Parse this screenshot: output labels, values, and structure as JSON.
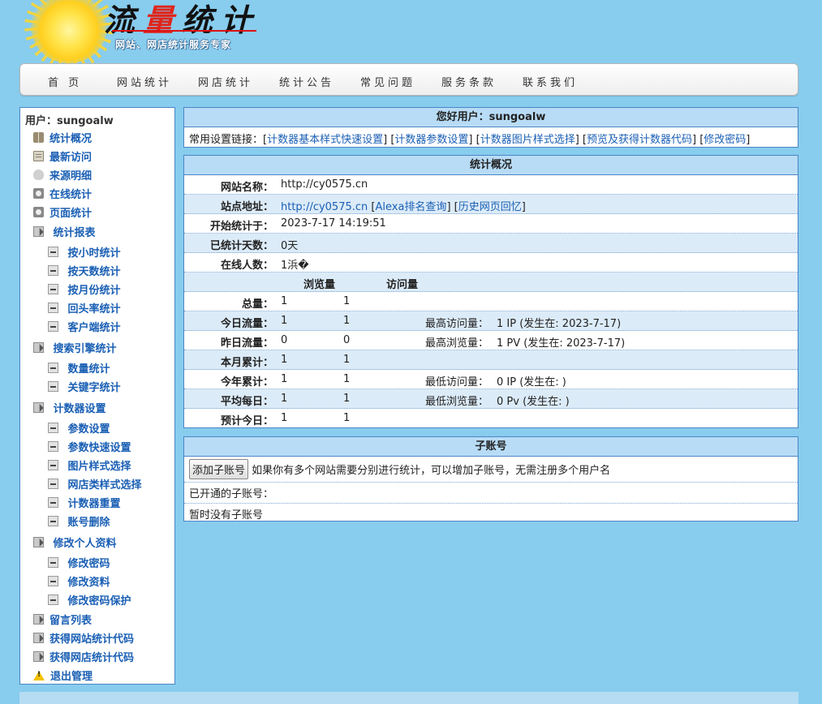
{
  "header": {
    "logo_title_left": "流",
    "logo_title_mid": "量",
    "logo_title_right": "统计",
    "logo_subtitle": "网站、网店统计服务专家"
  },
  "nav": [
    {
      "label": "首 页"
    },
    {
      "label": "网站统计"
    },
    {
      "label": "网店统计"
    },
    {
      "label": "统计公告"
    },
    {
      "label": "常见问题"
    },
    {
      "label": "服务条款"
    },
    {
      "label": "联系我们"
    }
  ],
  "sidebar": {
    "user_label": "用户：sungoalw",
    "items": [
      {
        "label": "统计概况",
        "icon": "book-icon"
      },
      {
        "label": "最新访问",
        "icon": "document-icon"
      },
      {
        "label": "来源明细",
        "icon": "cloud-icon"
      },
      {
        "label": "在线统计",
        "icon": "disc-icon"
      },
      {
        "label": "页面统计",
        "icon": "disc-icon"
      },
      {
        "label": "统计报表",
        "icon": "folder-icon"
      },
      {
        "label": "按小时统计",
        "icon": "minus-icon"
      },
      {
        "label": "按天数统计",
        "icon": "minus-icon"
      },
      {
        "label": "按月份统计",
        "icon": "minus-icon"
      },
      {
        "label": "回头率统计",
        "icon": "minus-icon"
      },
      {
        "label": "客户端统计",
        "icon": "minus-icon"
      },
      {
        "label": "搜索引擎统计",
        "icon": "folder-icon"
      },
      {
        "label": "数量统计",
        "icon": "minus-icon"
      },
      {
        "label": "关键字统计",
        "icon": "minus-icon"
      },
      {
        "label": "计数器设置",
        "icon": "folder-icon"
      },
      {
        "label": "参数设置",
        "icon": "minus-icon"
      },
      {
        "label": "参数快速设置",
        "icon": "minus-icon"
      },
      {
        "label": "图片样式选择",
        "icon": "minus-icon"
      },
      {
        "label": "网店类样式选择",
        "icon": "minus-icon"
      },
      {
        "label": "计数器重置",
        "icon": "minus-icon"
      },
      {
        "label": "账号删除",
        "icon": "minus-icon"
      },
      {
        "label": "修改个人资料",
        "icon": "folder-icon"
      },
      {
        "label": "修改密码",
        "icon": "minus-icon"
      },
      {
        "label": "修改资料",
        "icon": "minus-icon"
      },
      {
        "label": "修改密码保护",
        "icon": "minus-icon"
      },
      {
        "label": "留言列表",
        "icon": "folder-icon"
      },
      {
        "label": "获得网站统计代码",
        "icon": "folder-icon"
      },
      {
        "label": "获得网店统计代码",
        "icon": "folder-icon"
      },
      {
        "label": "退出管理",
        "icon": "warning-icon"
      }
    ]
  },
  "welcome": {
    "title": "您好用户：sungoalw",
    "links_prefix": "常用设置链接：",
    "links": [
      "计数器基本样式快速设置",
      "计数器参数设置",
      "计数器图片样式选择",
      "预览及获得计数器代码",
      "修改密码"
    ]
  },
  "overview": {
    "title": "统计概况",
    "site_name_label": "网站名称：",
    "site_name": "http://cy0575.cn",
    "site_url_label": "站点地址：",
    "site_url": "http://cy0575.cn",
    "alexa_link": "Alexa排名查询",
    "history_link": "历史网页回忆",
    "start_label": "开始统计于：",
    "start_value": "2023-7-17 14:19:51",
    "days_label": "已统计天数：",
    "days_value": "0天",
    "online_label": "在线人数：",
    "online_value": "1浜�",
    "col_pv": "浏览量",
    "col_ip": "访问量",
    "rows": [
      {
        "label": "总量：",
        "pv": "1",
        "ip": "1",
        "extra_label": "",
        "extra_value": ""
      },
      {
        "label": "今日流量：",
        "pv": "1",
        "ip": "1",
        "extra_label": "最高访问量：",
        "extra_value": "1 IP (发生在: 2023-7-17)"
      },
      {
        "label": "昨日流量：",
        "pv": "0",
        "ip": "0",
        "extra_label": "最高浏览量：",
        "extra_value": "1 PV (发生在: 2023-7-17)"
      },
      {
        "label": "本月累计：",
        "pv": "1",
        "ip": "1",
        "extra_label": "",
        "extra_value": ""
      },
      {
        "label": "今年累计：",
        "pv": "1",
        "ip": "1",
        "extra_label": "最低访问量：",
        "extra_value": "0 IP (发生在: )"
      },
      {
        "label": "平均每日：",
        "pv": "1",
        "ip": "1",
        "extra_label": "最低浏览量：",
        "extra_value": "0 Pv (发生在: )"
      },
      {
        "label": "预计今日：",
        "pv": "1",
        "ip": "1",
        "extra_label": "",
        "extra_value": ""
      }
    ]
  },
  "subaccount": {
    "title": "子账号",
    "add_button": "添加子账号",
    "add_hint": "如果你有多个网站需要分别进行统计，可以增加子账号，无需注册多个用户名",
    "opened_label": "已开通的子账号：",
    "none_text": "暂时没有子账号"
  },
  "colors": {
    "page_bg": "#88ccee",
    "panel_border": "#4a86c5",
    "panel_head_bg": "#b8dcf6",
    "link": "#1a5fb4",
    "logo_red": "#e0241a"
  }
}
